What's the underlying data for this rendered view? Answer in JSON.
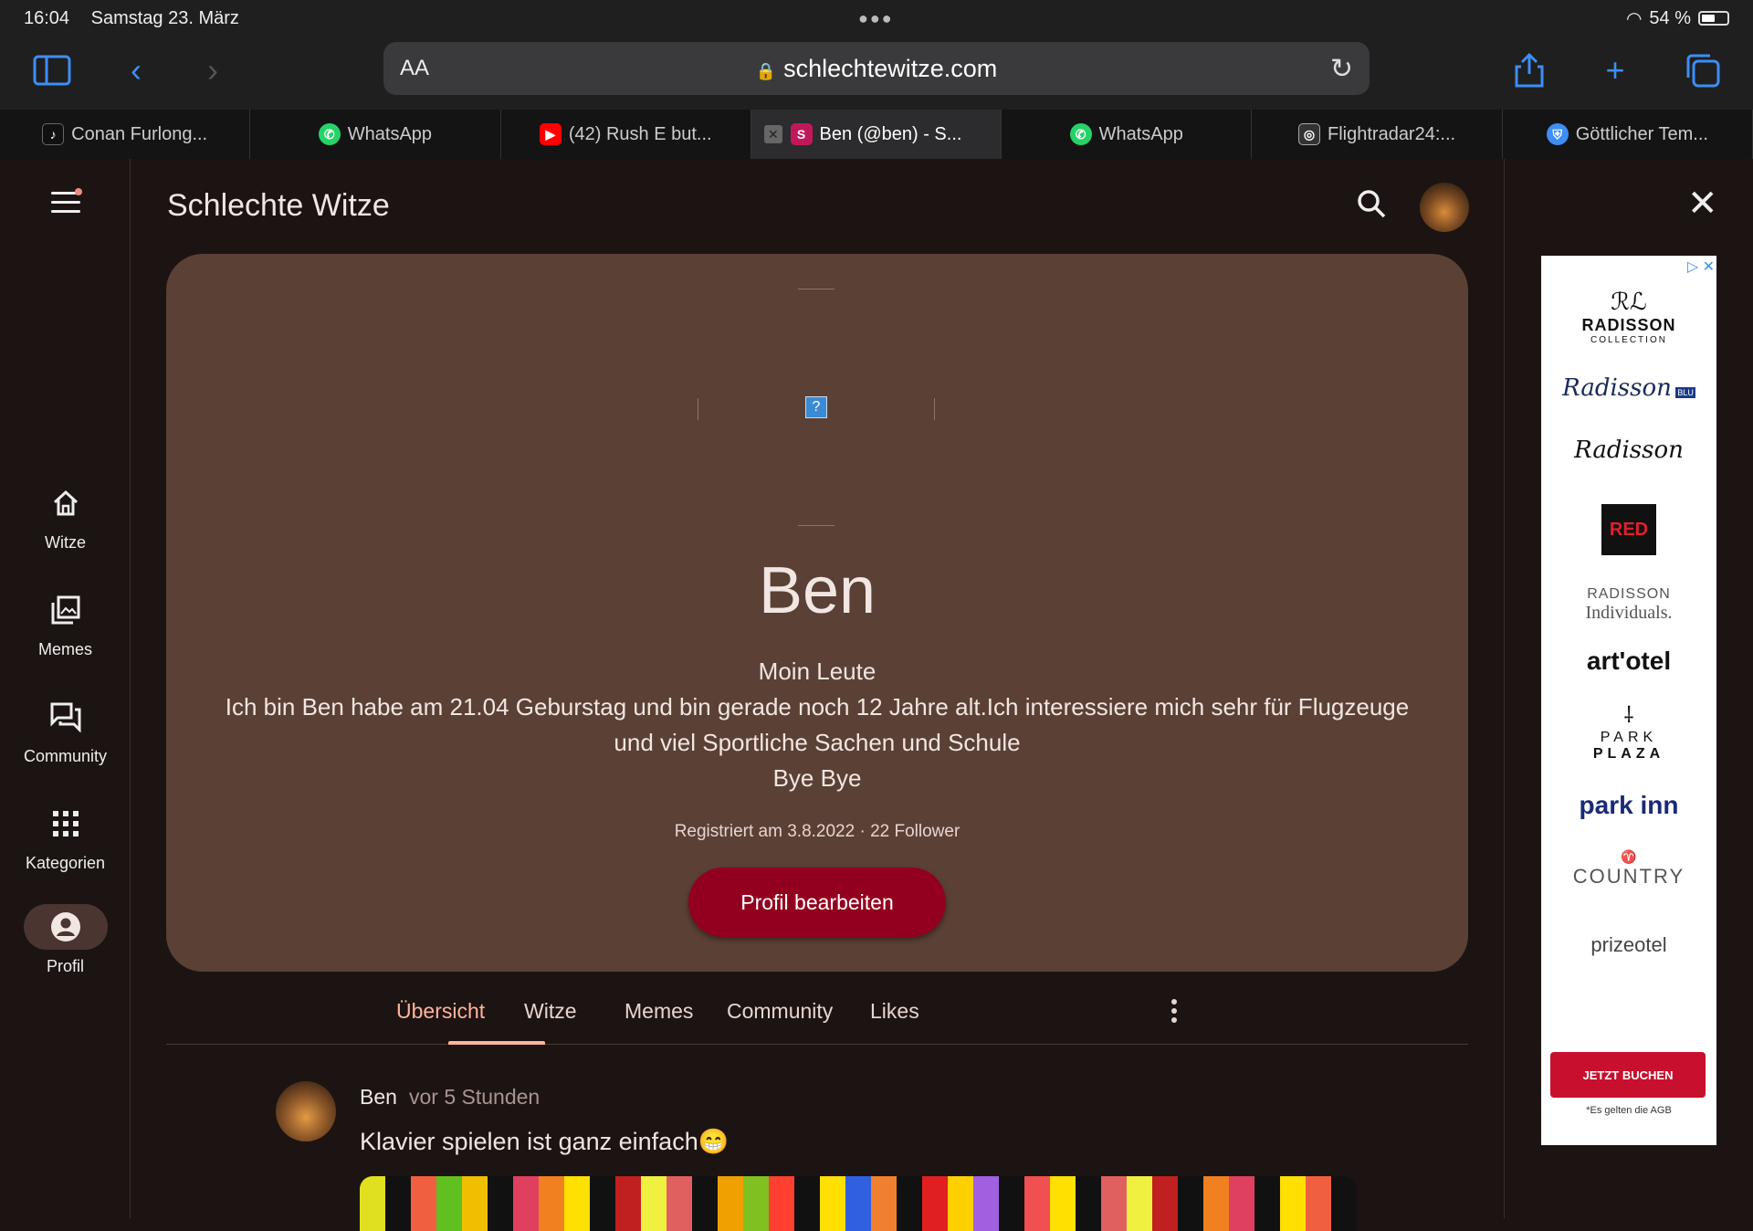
{
  "status": {
    "time": "16:04",
    "date": "Samstag 23. März",
    "battery": "54 %"
  },
  "browser": {
    "aa": "AA",
    "url": "schlechtewitze.com",
    "tabs": [
      {
        "label": "Conan Furlong...",
        "fav": "tiktok-icon",
        "color": "#111111"
      },
      {
        "label": "WhatsApp",
        "fav": "whatsapp-icon",
        "color": "#25d366"
      },
      {
        "label": "(42) Rush E but...",
        "fav": "youtube-icon",
        "color": "#ff0000"
      },
      {
        "label": "Ben (@ben) - S...",
        "fav": "site-s-icon",
        "color": "#c2185b"
      },
      {
        "label": "WhatsApp",
        "fav": "whatsapp-icon",
        "color": "#25d366"
      },
      {
        "label": "Flightradar24:...",
        "fav": "flightradar-icon",
        "color": "#333333"
      },
      {
        "label": "Göttlicher Tem...",
        "fav": "shield-icon",
        "color": "#3d8ef5"
      }
    ]
  },
  "sidebar": {
    "items": [
      {
        "label": "Witze",
        "icon": "home-icon"
      },
      {
        "label": "Memes",
        "icon": "gallery-icon"
      },
      {
        "label": "Community",
        "icon": "forum-icon"
      },
      {
        "label": "Kategorien",
        "icon": "grid-icon"
      },
      {
        "label": "Profil",
        "icon": "account-icon"
      }
    ]
  },
  "header": {
    "title": "Schlechte Witze"
  },
  "profile": {
    "name": "Ben",
    "bio_lines": [
      "Moin Leute",
      "Ich bin Ben habe am 21.04 Geburstag und bin gerade noch 12 Jahre alt.Ich interessiere mich sehr für Flugzeuge",
      "und viel Sportliche Sachen und Schule",
      "Bye Bye"
    ],
    "meta": "Registriert am 3.8.2022 · 22 Follower",
    "edit_button": "Profil bearbeiten"
  },
  "profile_tabs": [
    "Übersicht",
    "Witze",
    "Memes",
    "Community",
    "Likes"
  ],
  "post": {
    "author": "Ben",
    "time": "vor 5 Stunden",
    "text": "Klavier spielen ist ganz einfach😁"
  },
  "ad": {
    "brands": [
      "RADISSON",
      "COLLECTION",
      "Radisson",
      "BLU",
      "Radisson",
      "RED",
      "RADISSON",
      "Individuals.",
      "art'otel",
      "PARK",
      "PLAZA",
      "park inn",
      "COUNTRY",
      "prizeotel"
    ],
    "button": "JETZT BUCHEN",
    "fine": "*Es gelten die AGB"
  },
  "colors": {
    "accent": "#ffb59c",
    "button": "#93001f",
    "card": "#5b4035",
    "background": "#1c1412"
  }
}
